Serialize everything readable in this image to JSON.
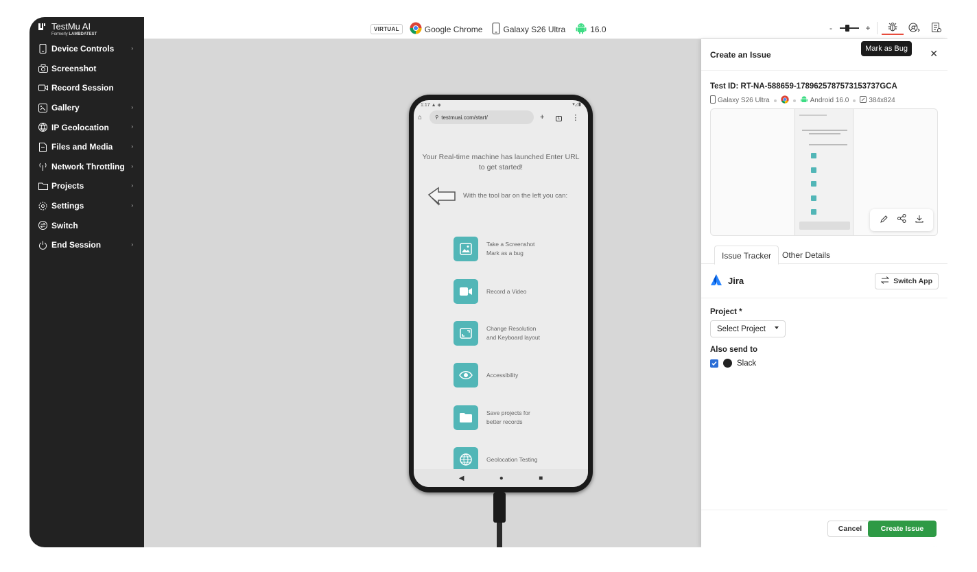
{
  "brand": {
    "name": "TestMu AI",
    "formerly": "Formerly",
    "formerly_brand": "LAMBDATEST"
  },
  "sidebar": {
    "items": [
      {
        "label": "Device Controls",
        "icon": "phone-icon",
        "has_submenu": true
      },
      {
        "label": "Screenshot",
        "icon": "camera-icon",
        "has_submenu": false
      },
      {
        "label": "Record Session",
        "icon": "video-icon",
        "has_submenu": false
      },
      {
        "label": "Gallery",
        "icon": "gallery-icon",
        "has_submenu": true
      },
      {
        "label": "IP Geolocation",
        "icon": "globe-icon",
        "has_submenu": true
      },
      {
        "label": "Files and Media",
        "icon": "file-icon",
        "has_submenu": true
      },
      {
        "label": "Network Throttling",
        "icon": "antenna-icon",
        "has_submenu": true
      },
      {
        "label": "Projects",
        "icon": "folder-icon",
        "has_submenu": true
      },
      {
        "label": "Settings",
        "icon": "gear-icon",
        "has_submenu": true
      },
      {
        "label": "Switch",
        "icon": "switch-icon",
        "has_submenu": false
      },
      {
        "label": "End Session",
        "icon": "power-icon",
        "has_submenu": true
      }
    ]
  },
  "topbar": {
    "badge": "VIRTUAL",
    "browser": "Google Chrome",
    "device": "Galaxy S26 Ultra",
    "os_version": "16.0",
    "zoom_minus": "-",
    "zoom_plus": "+",
    "tooltip": "Mark as Bug"
  },
  "phone": {
    "time": "1:17",
    "url": "testmuai.com/start/",
    "intro": "Your Real-time machine has launched Enter URL to get started!",
    "toolbar_hint": "With the tool bar on the left you can:",
    "features": [
      {
        "line1": "Take a Screenshot",
        "line2": "Mark as a bug",
        "icon": "image-icon"
      },
      {
        "line1": "Record a Video",
        "line2": "",
        "icon": "video-icon"
      },
      {
        "line1": "Change Resolution",
        "line2": "and Keyboard layout",
        "icon": "resize-icon"
      },
      {
        "line1": "Accessibility",
        "line2": "",
        "icon": "eye-icon"
      },
      {
        "line1": "Save projects for",
        "line2": "better records",
        "icon": "folder-icon"
      },
      {
        "line1": "Geolocation Testing",
        "line2": "",
        "icon": "globe-icon"
      }
    ]
  },
  "issue": {
    "title": "Create an Issue",
    "test_id": "Test ID: RT-NA-588659-1789625787573153737GCA",
    "meta_device": "Galaxy S26 Ultra",
    "meta_os": "Android 16.0",
    "meta_resolution": "384x824",
    "tabs": [
      "Issue Tracker",
      "Other Details"
    ],
    "tracker": "Jira",
    "switch_app": "Switch App",
    "project_label": "Project *",
    "project_value": "Select Project",
    "also_send_label": "Also send to",
    "slack_label": "Slack",
    "slack_checked": true,
    "cancel": "Cancel",
    "create": "Create Issue"
  },
  "colors": {
    "sidebar_bg": "#222222",
    "accent_teal": "#52b6b7",
    "create_green": "#2e9a45",
    "checkbox_blue": "#2b6ed6",
    "active_tool_underline": "#e74c3c"
  }
}
